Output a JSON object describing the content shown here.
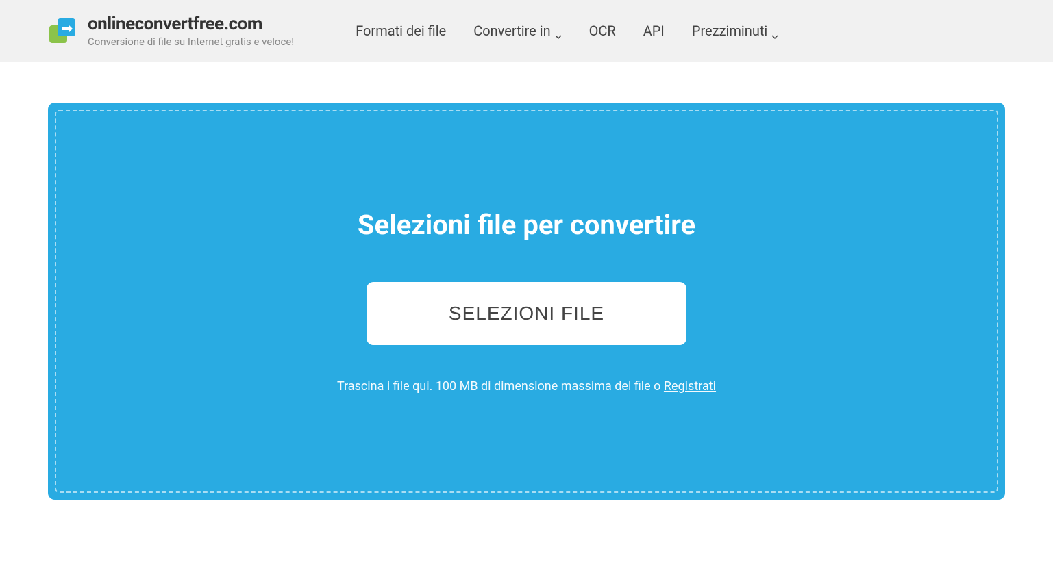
{
  "header": {
    "logo_title": "onlineconvertfree.com",
    "logo_subtitle": "Conversione di file su Internet gratis e veloce!",
    "nav": [
      {
        "label": "Formati dei file",
        "has_dropdown": false
      },
      {
        "label": "Convertire in",
        "has_dropdown": true
      },
      {
        "label": "OCR",
        "has_dropdown": false
      },
      {
        "label": "API",
        "has_dropdown": false
      },
      {
        "label": "Prezziminuti",
        "has_dropdown": true
      }
    ]
  },
  "dropzone": {
    "title": "Selezioni file per convertire",
    "button_label": "SELEZIONI FILE",
    "hint_prefix": "Trascina i file qui. 100 MB di dimensione massima del file o ",
    "hint_link": "Registrati"
  }
}
